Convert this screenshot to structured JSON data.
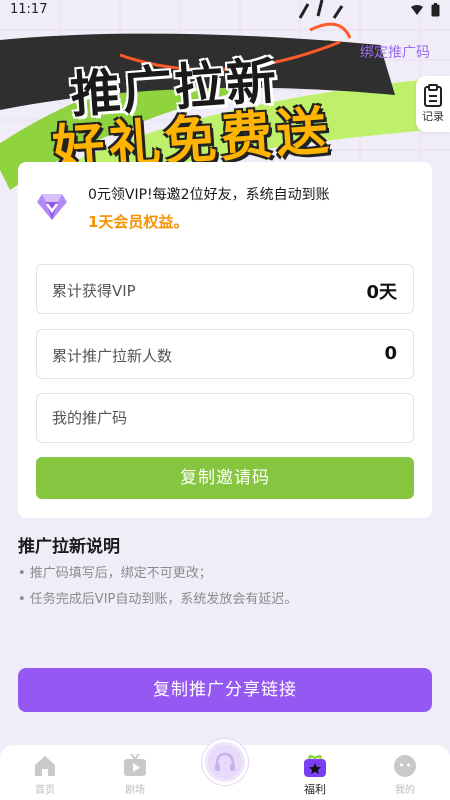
{
  "status": {
    "time": "11:17"
  },
  "hero": {
    "title_line1": "推广拉新",
    "title_line2": "好礼免费送"
  },
  "header": {
    "bind_code_label": "绑定推广码",
    "record_label": "记录"
  },
  "promo": {
    "line1": "0元领VIP!每邀2位好友，系统自动到账",
    "line2": "1天会员权益。"
  },
  "stats": {
    "vip_label": "累计获得VIP",
    "vip_value": "0天",
    "invites_label": "累计推广拉新人数",
    "invites_value": "0"
  },
  "code_field": {
    "placeholder": "我的推广码"
  },
  "buttons": {
    "copy_invite": "复制邀请码",
    "copy_share": "复制推广分享链接"
  },
  "instructions": {
    "title": "推广拉新说明",
    "items": [
      "• 推广码填写后，绑定不可更改；",
      "• 任务完成后VIP自动到账，系统发放会有延迟。"
    ]
  },
  "nav": {
    "items": [
      {
        "label": "首页",
        "icon": "home-icon"
      },
      {
        "label": "剧场",
        "icon": "tv-icon"
      },
      {
        "label": "",
        "icon": "headphones-icon"
      },
      {
        "label": "福利",
        "icon": "gift-icon"
      },
      {
        "label": "我的",
        "icon": "profile-icon"
      }
    ],
    "active_index": 3
  },
  "colors": {
    "accent_green": "#86c540",
    "accent_purple": "#9658f2",
    "orange_text": "#f59300",
    "link_purple": "#9b6cf0"
  }
}
